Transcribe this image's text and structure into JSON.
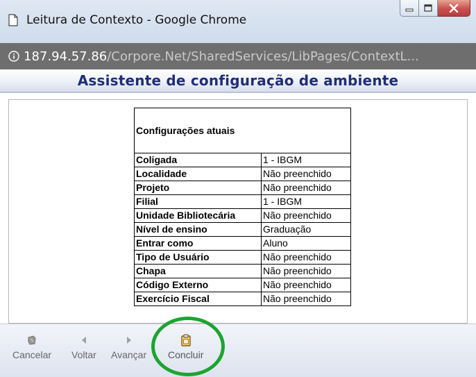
{
  "window": {
    "title": "Leitura de Contexto - Google Chrome"
  },
  "address": {
    "host": "187.94.57.86",
    "path": "/Corpore.Net/SharedServices/LibPages/ContextL..."
  },
  "header": {
    "title": "Assistente de configuração de ambiente"
  },
  "config_table": {
    "heading": "Configurações atuais",
    "rows": [
      {
        "label": "Coligada",
        "value": "1 - IBGM"
      },
      {
        "label": "Localidade",
        "value": "Não preenchido"
      },
      {
        "label": "Projeto",
        "value": "Não preenchido"
      },
      {
        "label": "Filial",
        "value": "1 - IBGM"
      },
      {
        "label": "Unidade Bibliotecária",
        "value": "Não preenchido"
      },
      {
        "label": "Nível de ensino",
        "value": "Graduação"
      },
      {
        "label": "Entrar como",
        "value": "Aluno"
      },
      {
        "label": "Tipo de Usuário",
        "value": "Não preenchido"
      },
      {
        "label": "Chapa",
        "value": "Não preenchido"
      },
      {
        "label": "Código Externo",
        "value": "Não preenchido"
      },
      {
        "label": "Exercício Fiscal",
        "value": "Não preenchido"
      }
    ]
  },
  "toolbar": {
    "cancel_label": "Cancelar",
    "back_label": "Voltar",
    "next_label": "Avançar",
    "finish_label": "Concluir"
  },
  "colors": {
    "header_text": "#1f2d7a",
    "highlight_circle": "#1ba52f",
    "address_bar": "#6e6e6e"
  }
}
